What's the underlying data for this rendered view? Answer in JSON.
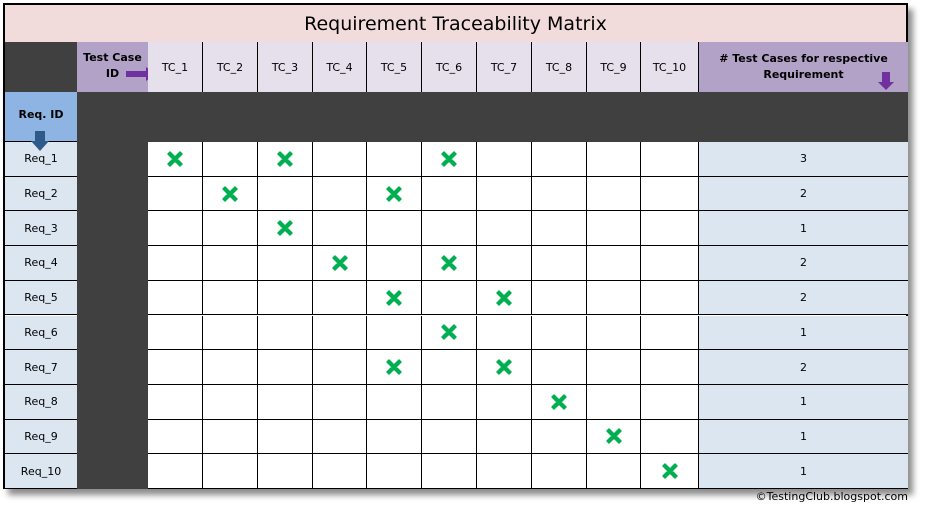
{
  "title": "Requirement Traceability Matrix",
  "header": {
    "test_case_label": "Test Case ID",
    "req_id_label": "Req. ID",
    "count_label": "# Test Cases for respective Requirement"
  },
  "test_cases": [
    "TC_1",
    "TC_2",
    "TC_3",
    "TC_4",
    "TC_5",
    "TC_6",
    "TC_7",
    "TC_8",
    "TC_9",
    "TC_10"
  ],
  "requirements": [
    {
      "id": "Req_1",
      "covered": [
        "TC_1",
        "TC_3",
        "TC_6"
      ],
      "count": "3"
    },
    {
      "id": "Req_2",
      "covered": [
        "TC_2",
        "TC_5"
      ],
      "count": "2"
    },
    {
      "id": "Req_3",
      "covered": [
        "TC_3"
      ],
      "count": "1"
    },
    {
      "id": "Req_4",
      "covered": [
        "TC_4",
        "TC_6"
      ],
      "count": "2"
    },
    {
      "id": "Req_5",
      "covered": [
        "TC_5",
        "TC_7"
      ],
      "count": "2"
    },
    {
      "id": "Req_6",
      "covered": [
        "TC_6"
      ],
      "count": "1"
    },
    {
      "id": "Req_7",
      "covered": [
        "TC_5",
        "TC_7"
      ],
      "count": "2"
    },
    {
      "id": "Req_8",
      "covered": [
        "TC_8"
      ],
      "count": "1"
    },
    {
      "id": "Req_9",
      "covered": [
        "TC_9"
      ],
      "count": "1"
    },
    {
      "id": "Req_10",
      "covered": [
        "TC_10"
      ],
      "count": "1"
    }
  ],
  "colors": {
    "mark": "#00b050",
    "arrow_purple": "#7030a0",
    "arrow_blue": "#2e5a8a"
  },
  "footer": "©TestingClub.blogspot.com"
}
